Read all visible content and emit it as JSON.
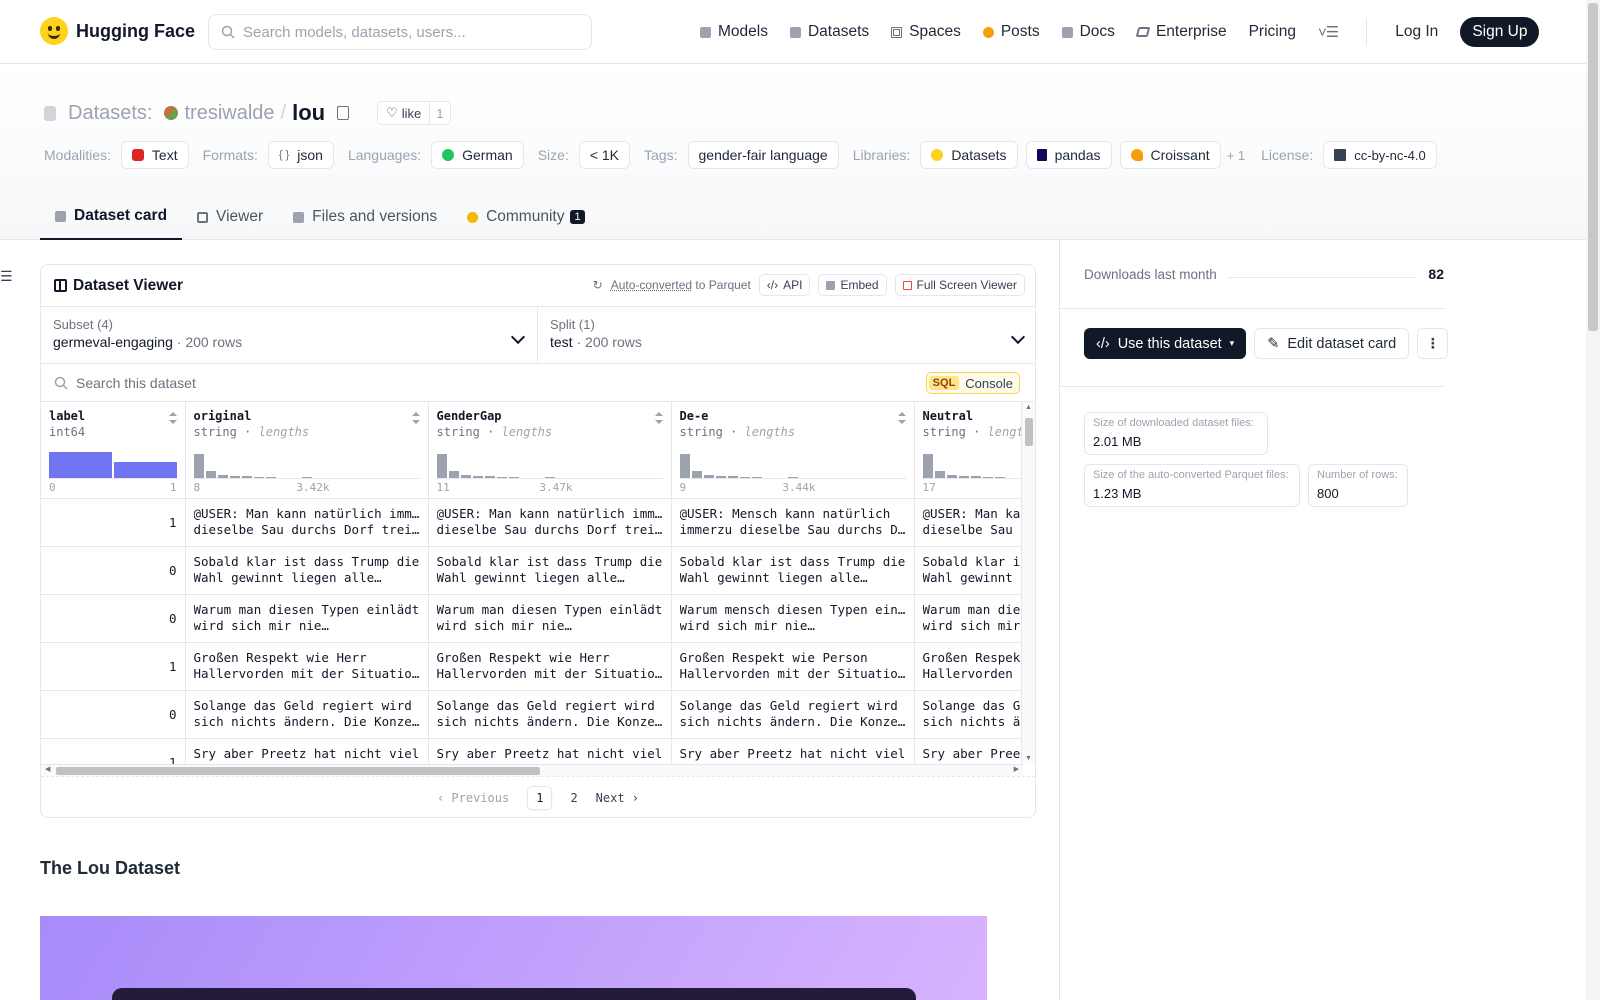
{
  "header": {
    "brand": "Hugging Face",
    "search_placeholder": "Search models, datasets, users...",
    "nav": [
      "Models",
      "Datasets",
      "Spaces",
      "Posts",
      "Docs",
      "Enterprise",
      "Pricing"
    ],
    "login": "Log In",
    "signup": "Sign Up"
  },
  "repo": {
    "section": "Datasets:",
    "owner": "tresiwalde",
    "separator": "/",
    "name": "lou",
    "like_label": "like",
    "like_count": "1"
  },
  "tags": {
    "modalities_label": "Modalities:",
    "modality": "Text",
    "formats_label": "Formats:",
    "format": "json",
    "languages_label": "Languages:",
    "language": "German",
    "size_label": "Size:",
    "size": "< 1K",
    "tags_label": "Tags:",
    "tag": "gender-fair language",
    "libraries_label": "Libraries:",
    "libraries": [
      "Datasets",
      "pandas",
      "Croissant"
    ],
    "libraries_more": "+ 1",
    "license_label": "License:",
    "license": "cc-by-nc-4.0"
  },
  "tabs": [
    {
      "label": "Dataset card"
    },
    {
      "label": "Viewer"
    },
    {
      "label": "Files and versions"
    },
    {
      "label": "Community",
      "badge": "1"
    }
  ],
  "viewer": {
    "title": "Dataset Viewer",
    "auto_converted": "Auto-converted",
    "to_parquet": "to Parquet",
    "api": "API",
    "embed": "Embed",
    "full_screen": "Full Screen Viewer",
    "subset_label": "Subset (4)",
    "subset_value": "germeval-engaging",
    "subset_rows": "200 rows",
    "split_label": "Split (1)",
    "split_value": "test",
    "split_rows": "200 rows",
    "search_placeholder": "Search this dataset",
    "sql_tag": "SQL",
    "sql_label": "Console",
    "dot": "·",
    "columns": [
      {
        "name": "label",
        "type": "int64",
        "min": "0",
        "max": "1"
      },
      {
        "name": "original",
        "type": "string",
        "sub": "lengths",
        "min": "8",
        "max": "3.42k"
      },
      {
        "name": "GenderGap",
        "type": "string",
        "sub": "lengths",
        "min": "11",
        "max": "3.47k"
      },
      {
        "name": "De-e",
        "type": "string",
        "sub": "lengths",
        "min": "9",
        "max": "3.44k"
      },
      {
        "name": "Neutral",
        "type": "string",
        "sub": "lengths",
        "min": "17",
        "max": ""
      }
    ],
    "rows": [
      {
        "label": "1",
        "original": [
          "@USER: Man kann natürlich immerzu",
          "dieselbe Sau durchs Dorf treiben…"
        ],
        "gendergap": [
          "@USER: Man kann natürlich immerzu",
          "dieselbe Sau durchs Dorf treiben…"
        ],
        "dee": [
          "@USER: Mensch kann natürlich",
          "immerzu dieselbe Sau durchs Dorf…"
        ],
        "neutral": [
          "@USER: Man kann natürlich immerzu",
          "dieselbe Sau durchs Dorf treiben…"
        ]
      },
      {
        "label": "0",
        "original": [
          "Sobald klar ist dass Trump die",
          "Wahl gewinnt liegen alle…"
        ],
        "gendergap": [
          "Sobald klar ist dass Trump die",
          "Wahl gewinnt liegen alle…"
        ],
        "dee": [
          "Sobald klar ist dass Trump die",
          "Wahl gewinnt liegen alle…"
        ],
        "neutral": [
          "Sobald klar ist dass Trump die",
          "Wahl gewinnt liegen alle…"
        ]
      },
      {
        "label": "0",
        "original": [
          "Warum man diesen Typen einlädt",
          "wird sich mir nie…"
        ],
        "gendergap": [
          "Warum man diesen Typen einlädt",
          "wird sich mir nie…"
        ],
        "dee": [
          "Warum mensch diesen Typen einlädt",
          "wird sich mir nie…"
        ],
        "neutral": [
          "Warum man diesen Typen einlädt",
          "wird sich mir nie…"
        ]
      },
      {
        "label": "1",
        "original": [
          "Großen Respekt wie Herr",
          "Hallervorden mit der Situation…"
        ],
        "gendergap": [
          "Großen Respekt wie Herr",
          "Hallervorden mit der Situation…"
        ],
        "dee": [
          "Großen Respekt wie Person",
          "Hallervorden mit der Situation…"
        ],
        "neutral": [
          "Großen Respekt wie Herr",
          "Hallervorden mit der Situation…"
        ]
      },
      {
        "label": "0",
        "original": [
          "Solange das Geld regiert wird",
          "sich nichts ändern. Die Konzerne…"
        ],
        "gendergap": [
          "Solange das Geld regiert wird",
          "sich nichts ändern. Die Konzerne…"
        ],
        "dee": [
          "Solange das Geld regiert wird",
          "sich nichts ändern. Die Konzerne…"
        ],
        "neutral": [
          "Solange das Geld regiert wird",
          "sich nichts ändern. Die Konzerne…"
        ]
      },
      {
        "label": "1",
        "original": [
          "Sry aber Preetz hat nicht viel",
          ""
        ],
        "gendergap": [
          "Sry aber Preetz hat nicht viel",
          ""
        ],
        "dee": [
          "Sry aber Preetz hat nicht viel",
          ""
        ],
        "neutral": [
          "Sry aber Preetz hat nicht viel",
          ""
        ]
      }
    ],
    "pager": {
      "prev": "Previous",
      "pages": [
        "1",
        "2"
      ],
      "next": "Next"
    }
  },
  "card": {
    "title": "The Lou Dataset"
  },
  "sidebar": {
    "downloads_label": "Downloads last month",
    "downloads_value": "82",
    "use_dataset": "Use this dataset",
    "edit_card": "Edit dataset card",
    "size_downloaded_label": "Size of downloaded dataset files:",
    "size_downloaded_value": "2.01 MB",
    "size_parquet_label": "Size of the auto-converted Parquet files:",
    "size_parquet_value": "1.23 MB",
    "num_rows_label": "Number of rows:",
    "num_rows_value": "800"
  },
  "colors": {
    "accent_dark": "#111827",
    "histogram_label": "#6366f1",
    "sql_bg": "#fde68a"
  }
}
